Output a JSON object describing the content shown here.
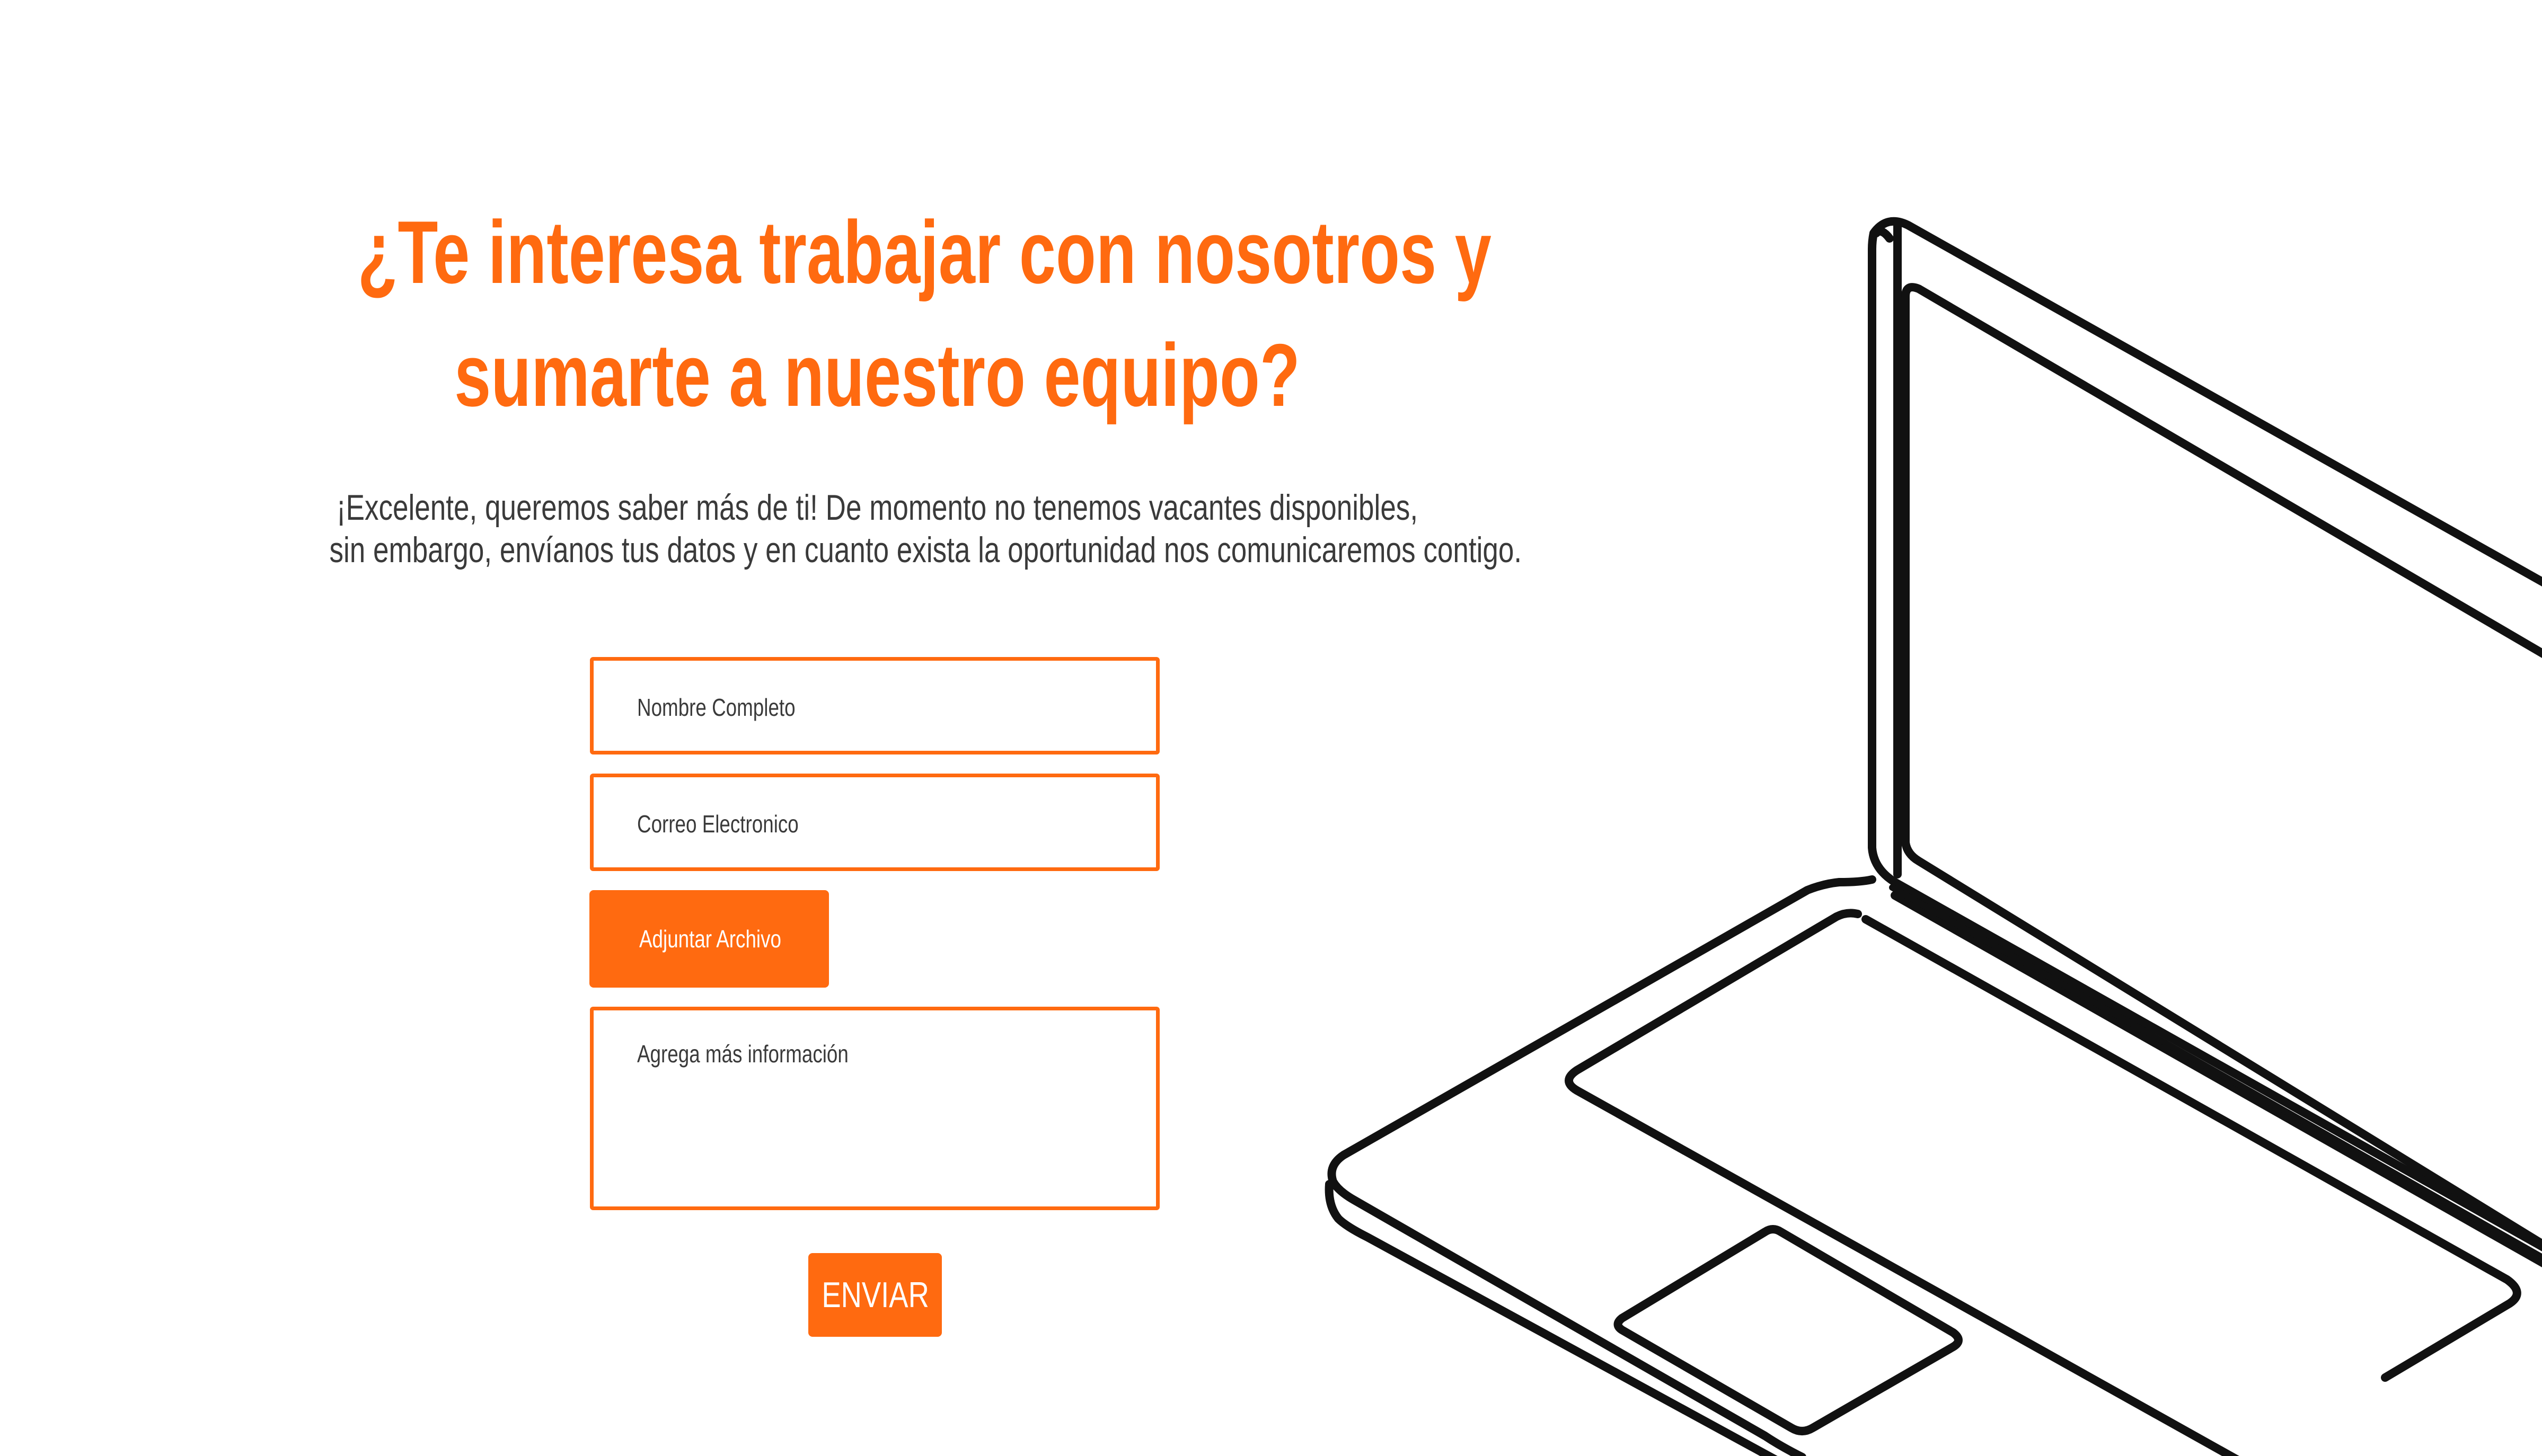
{
  "header": {
    "title_line1": "¿Te interesa trabajar con nosotros y",
    "title_line2": "sumarte a nuestro equipo?",
    "subtitle_line1": "¡Excelente, queremos saber más de ti! De momento no tenemos vacantes disponibles,",
    "subtitle_line2": "sin embargo, envíanos tus datos y en cuanto exista la oportunidad nos comunicaremos contigo."
  },
  "form": {
    "name_placeholder": "Nombre Completo",
    "email_placeholder": "Correo Electronico",
    "attach_label": "Adjuntar Archivo",
    "info_placeholder": "Agrega más información",
    "submit_label": "ENVIAR"
  },
  "colors": {
    "accent": "#ff6a10",
    "text": "#3a3a3a",
    "background": "#ffffff",
    "illustration_stroke": "#111111"
  },
  "illustration": {
    "icon": "laptop-outline-icon"
  }
}
